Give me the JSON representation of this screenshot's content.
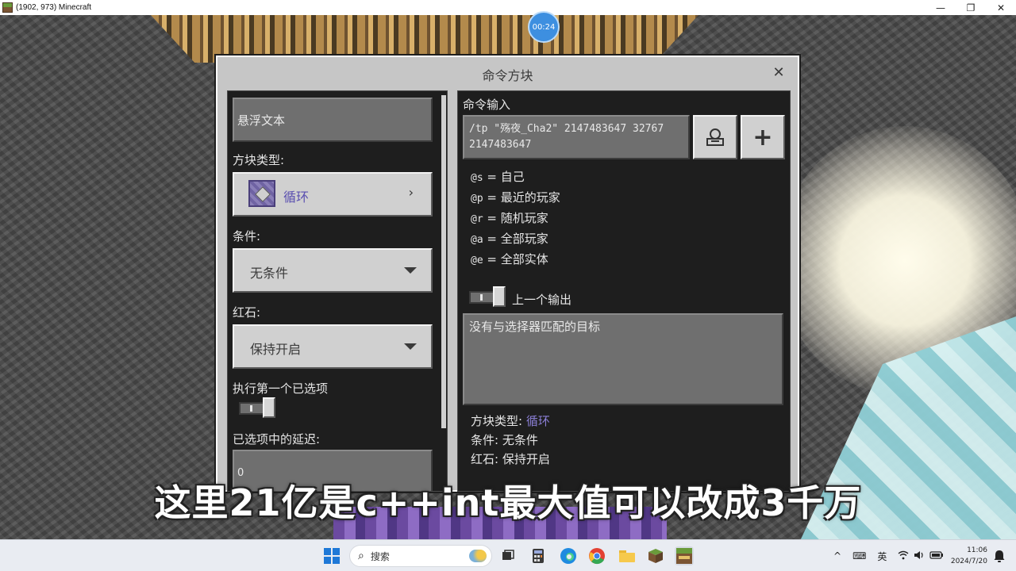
{
  "window": {
    "title": "(1902, 973) Minecraft",
    "controls": {
      "minimize": "—",
      "maximize": "❐",
      "close": "✕"
    }
  },
  "timer": "00:24",
  "dialog": {
    "title": "命令方块",
    "close_icon": "✕",
    "left": {
      "hover_text_placeholder": "悬浮文本",
      "block_type_label": "方块类型:",
      "block_type_value": "循环",
      "condition_label": "条件:",
      "condition_value": "无条件",
      "redstone_label": "红石:",
      "redstone_value": "保持开启",
      "execute_first_label": "执行第一个已选项",
      "delay_label": "已选项中的延迟:",
      "delay_value": "0"
    },
    "right": {
      "command_input_label": "命令输入",
      "command_line1": "/tp \"殇夜_Cha2\" 2147483647 32767",
      "command_line2": "2147483647",
      "selectors": [
        {
          "code": "@s",
          "eq": " = ",
          "desc": "自己"
        },
        {
          "code": "@p",
          "eq": " = ",
          "desc": "最近的玩家"
        },
        {
          "code": "@r",
          "eq": " = ",
          "desc": "随机玩家"
        },
        {
          "code": "@a",
          "eq": " = ",
          "desc": "全部玩家"
        },
        {
          "code": "@e",
          "eq": " = ",
          "desc": "全部实体"
        }
      ],
      "previous_output_label": "上一个输出",
      "output_text": "没有与选择器匹配的目标",
      "status_block_type_label": "方块类型: ",
      "status_block_type_value": "循环",
      "status_condition": "条件: 无条件",
      "status_redstone": "红石: 保持开启",
      "plus_icon": "+"
    }
  },
  "subtitle": "这里21亿是c++int最大值可以改成3千万",
  "taskbar": {
    "search_placeholder": "搜索",
    "search_icon": "⌕",
    "tray_lang": "英",
    "tray_up": "^",
    "clock_time": "11:06",
    "clock_date": "2024/7/20"
  },
  "colors": {
    "accent_purple": "#8b7fd6",
    "dialog_bg": "#c6c6c6",
    "pane_bg": "#1e1e1e"
  }
}
